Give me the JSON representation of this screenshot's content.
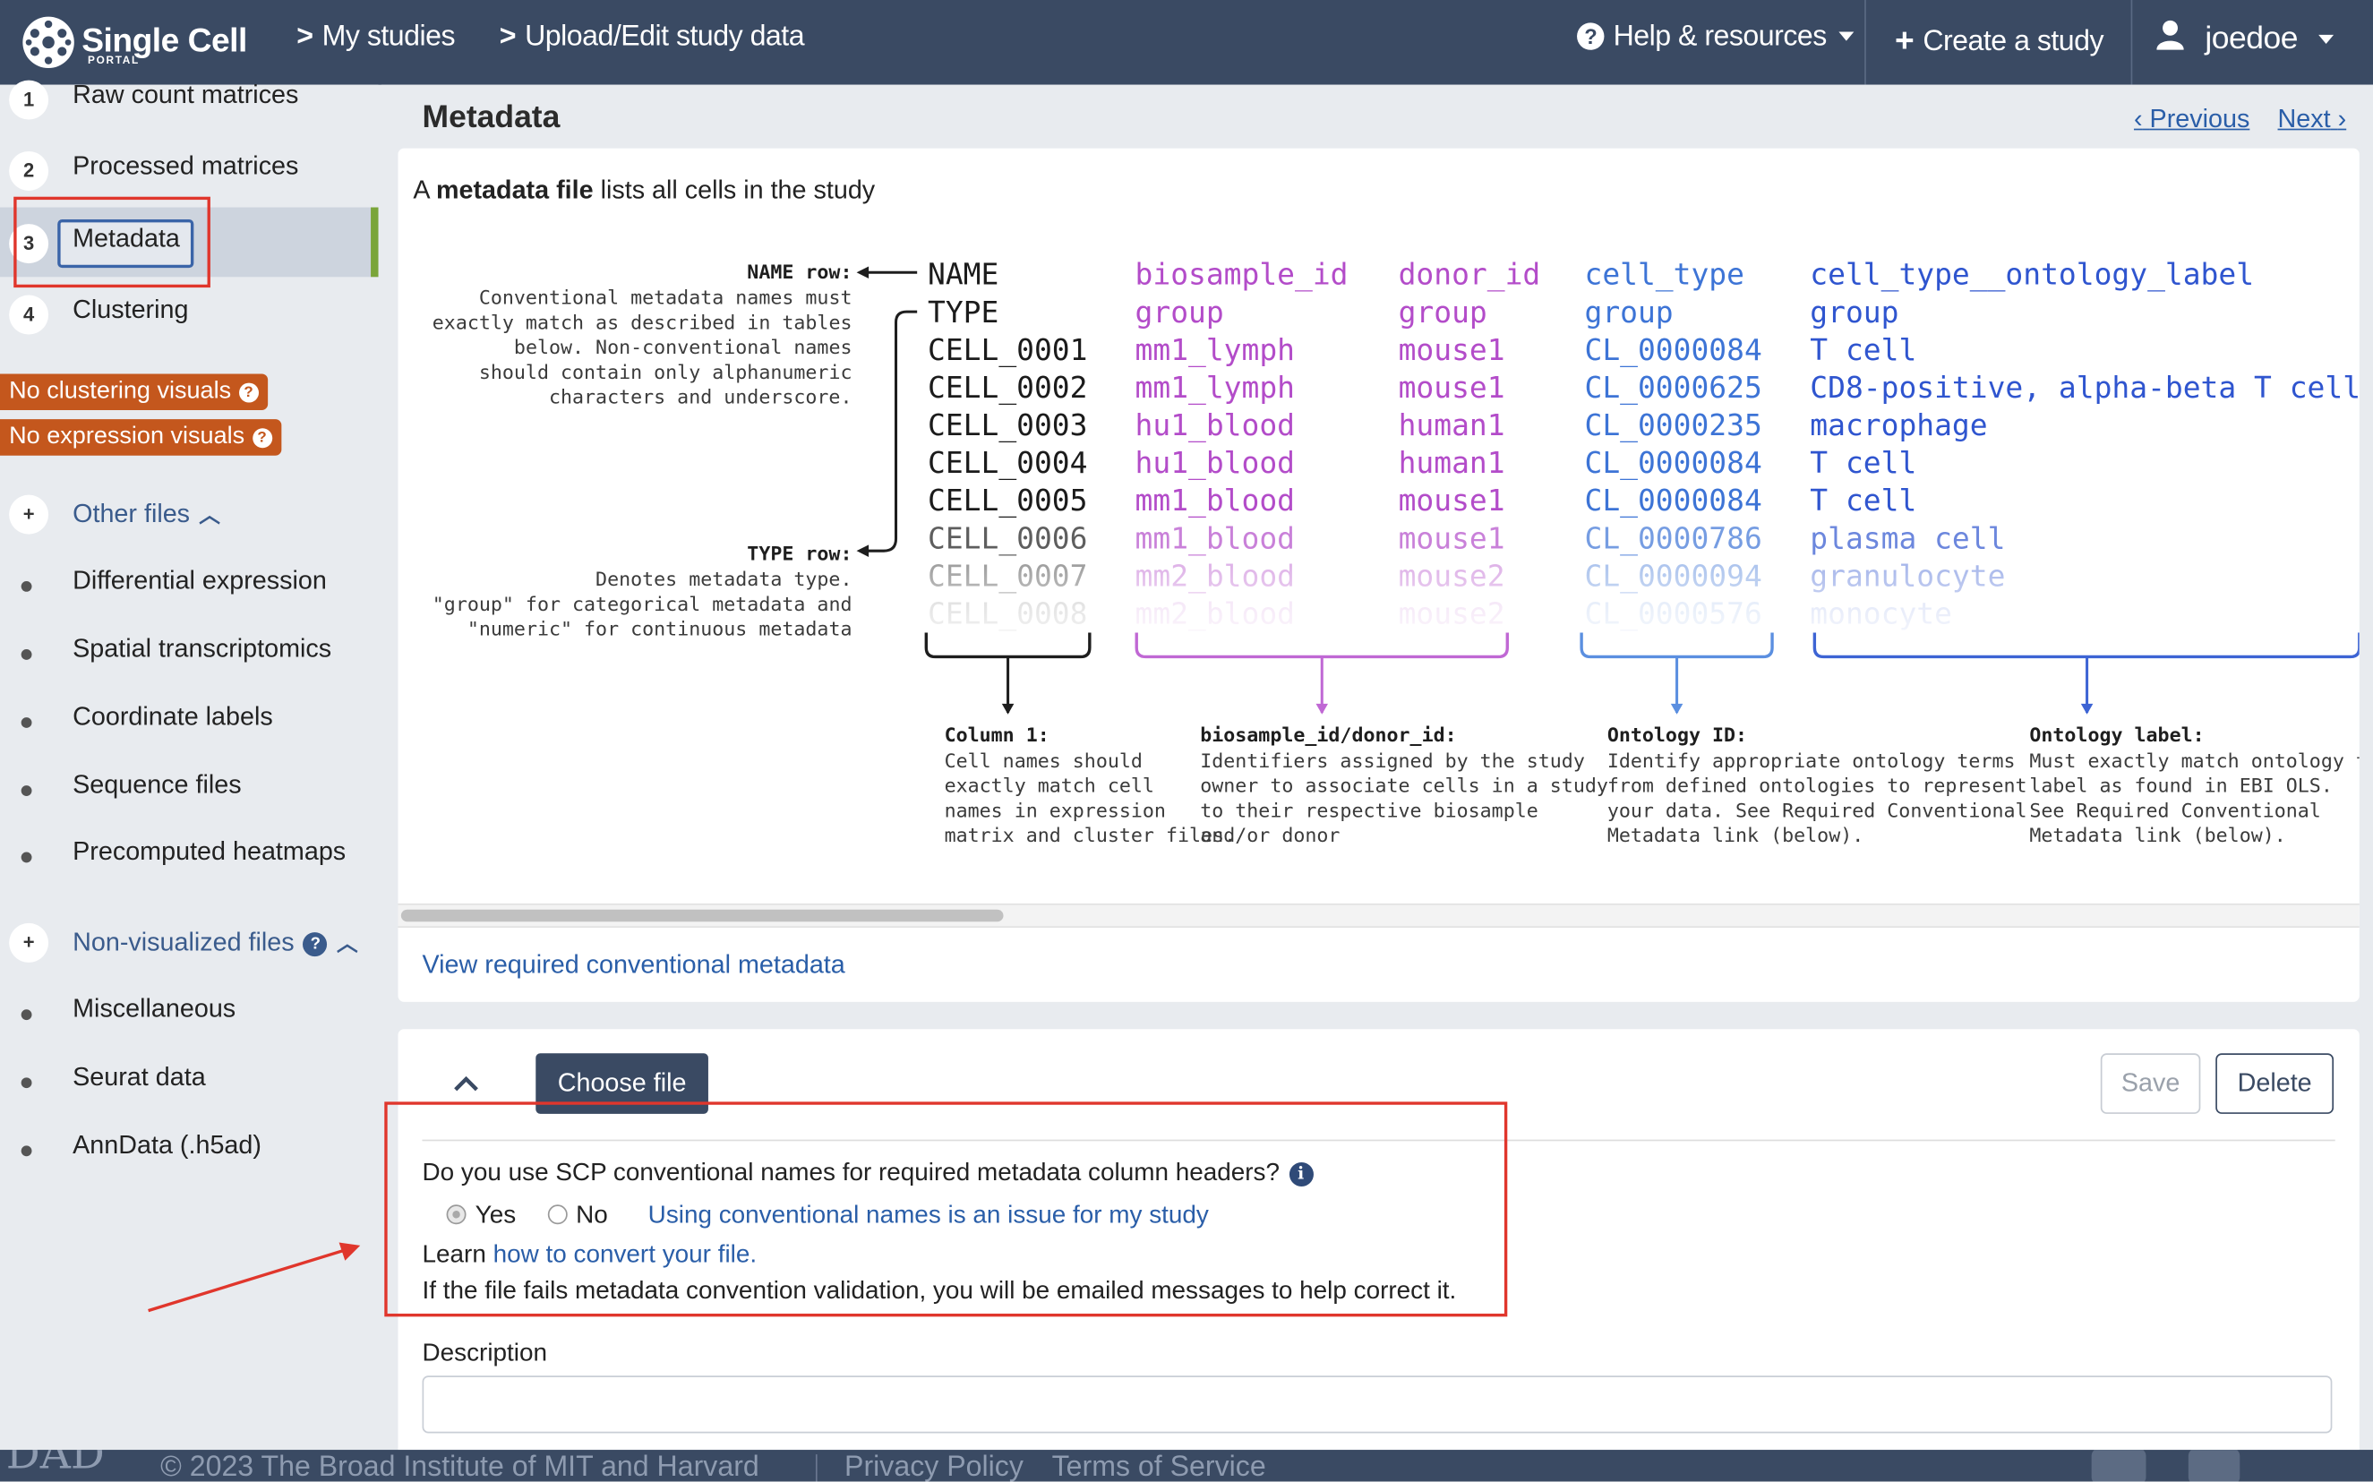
{
  "nav": {
    "logo_title": "Single Cell",
    "logo_sub": "PORTAL",
    "my_studies": "My studies",
    "upload_edit": "Upload/Edit study data",
    "help": "Help & resources",
    "create_study": "Create a study",
    "user": "joedoe"
  },
  "sidebar": {
    "steps": [
      {
        "num": "1",
        "label": "Raw count matrices"
      },
      {
        "num": "2",
        "label": "Processed matrices"
      },
      {
        "num": "3",
        "label": "Metadata"
      },
      {
        "num": "4",
        "label": "Clustering"
      }
    ],
    "badges": [
      "No clustering visuals",
      "No expression visuals"
    ],
    "other_files": {
      "label": "Other files",
      "items": [
        "Differential expression",
        "Spatial transcriptomics",
        "Coordinate labels",
        "Sequence files",
        "Precomputed heatmaps"
      ]
    },
    "non_visualized": {
      "label": "Non-visualized files",
      "items": [
        "Miscellaneous",
        "Seurat data",
        "AnnData (.h5ad)"
      ]
    },
    "plus": "+"
  },
  "main": {
    "title": "Metadata",
    "previous": "Previous",
    "next": "Next",
    "intro_pre": "A ",
    "intro_bold": "metadata file",
    "intro_post": " lists all cells in the study",
    "view_required": "View required conventional metadata"
  },
  "diagram": {
    "name_row_title": "NAME row:",
    "name_row_desc": [
      "Conventional metadata names must",
      "exactly match as described in tables",
      "below. Non-conventional names",
      "should contain only alphanumeric",
      "characters and underscore."
    ],
    "type_row_title": "TYPE row:",
    "type_row_desc": [
      "Denotes metadata type.",
      "\"group\" for categorical metadata and",
      "\"numeric\" for continuous metadata"
    ],
    "columns": [
      {
        "cells": [
          "NAME",
          "TYPE",
          "CELL_0001",
          "CELL_0002",
          "CELL_0003",
          "CELL_0004",
          "CELL_0005",
          "CELL_0006",
          "CELL_0007",
          "CELL_0008"
        ],
        "color": "#1b1b1b"
      },
      {
        "cells": [
          "biosample_id",
          "group",
          "mm1_lymph",
          "mm1_lymph",
          "hu1_blood",
          "hu1_blood",
          "mm1_blood",
          "mm1_blood",
          "mm2_blood",
          "mm2_blood"
        ],
        "color": "#b34cc9"
      },
      {
        "cells": [
          "donor_id",
          "group",
          "mouse1",
          "mouse1",
          "human1",
          "human1",
          "mouse1",
          "mouse1",
          "mouse2",
          "mouse2"
        ],
        "color": "#b34cc9"
      },
      {
        "cells": [
          "cell_type",
          "group",
          "CL_0000084",
          "CL_0000625",
          "CL_0000235",
          "CL_0000084",
          "CL_0000084",
          "CL_0000786",
          "CL_0000094",
          "CL_0000576"
        ],
        "color": "#3d74d6"
      },
      {
        "cells": [
          "cell_type__ontology_label",
          "group",
          "T cell",
          "CD8-positive, alpha-beta T cell",
          "macrophage",
          "T cell",
          "T cell",
          "plasma cell",
          "granulocyte",
          "monocyte"
        ],
        "color": "#2f55cf"
      }
    ],
    "notes": [
      {
        "title": "Column 1:",
        "lines": [
          "Cell names should",
          "exactly match cell",
          "names in expression",
          "matrix and cluster files."
        ]
      },
      {
        "title": "biosample_id/donor_id:",
        "lines": [
          "Identifiers assigned by the study",
          "owner to associate cells in a study",
          "to their respective biosample",
          "and/or donor"
        ]
      },
      {
        "title": "Ontology ID:",
        "lines": [
          "Identify appropriate ontology terms",
          "from defined ontologies to represent",
          "your data. See Required Conventional",
          "Metadata link (below)."
        ]
      },
      {
        "title": "Ontology label:",
        "lines": [
          "Must exactly match ontology term's",
          "label as found in EBI OLS.",
          "See Required Conventional",
          "Metadata link (below)."
        ]
      }
    ]
  },
  "upload": {
    "choose_file": "Choose file",
    "save": "Save",
    "delete": "Delete",
    "question": "Do you use SCP conventional names for required metadata column headers?",
    "yes": "Yes",
    "no": "No",
    "selected": "Yes",
    "issue_link": "Using conventional names is an issue for my study",
    "learn_pre": "Learn ",
    "learn_link": "how to convert your file.",
    "fail_msg": "If the file fails metadata convention validation, you will be emailed messages to help correct it.",
    "description_label": "Description",
    "description_value": ""
  },
  "footer": {
    "logo": "DAD",
    "copyright": "© 2023 The Broad Institute of MIT and Harvard",
    "privacy": "Privacy Policy",
    "terms": "Terms of Service"
  },
  "colors": {
    "nav_bg": "#3a4a63",
    "accent_green": "#7aa53a",
    "badge_orange": "#c4571d",
    "link_blue": "#2a5ea8",
    "annotation_red": "#e0362c"
  }
}
